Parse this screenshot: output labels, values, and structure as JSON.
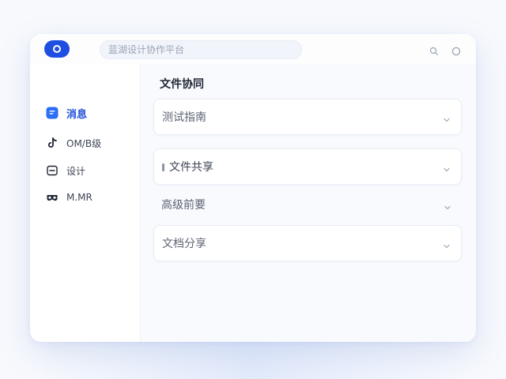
{
  "search": {
    "placeholder": "蓝湖设计协作平台"
  },
  "sidebar": {
    "items": [
      {
        "label": "消息",
        "icon": "message-icon",
        "active": true
      },
      {
        "label": "OM/B级",
        "icon": "tiktok-icon",
        "active": false
      },
      {
        "label": "设计",
        "icon": "design-icon",
        "active": false
      },
      {
        "label": "M.MR",
        "icon": "glasses-icon",
        "active": false
      }
    ]
  },
  "main": {
    "title": "文件协同",
    "sections": [
      {
        "label": "测试指南",
        "expanded": false
      },
      {
        "label": "文件共享",
        "expanded": false
      },
      {
        "label": "高级前要",
        "expanded": false
      },
      {
        "label": "文档分享",
        "expanded": false
      }
    ]
  },
  "colors": {
    "accent": "#1f4fe0",
    "window_bg": "#ffffff",
    "main_bg": "#f8fafd"
  }
}
